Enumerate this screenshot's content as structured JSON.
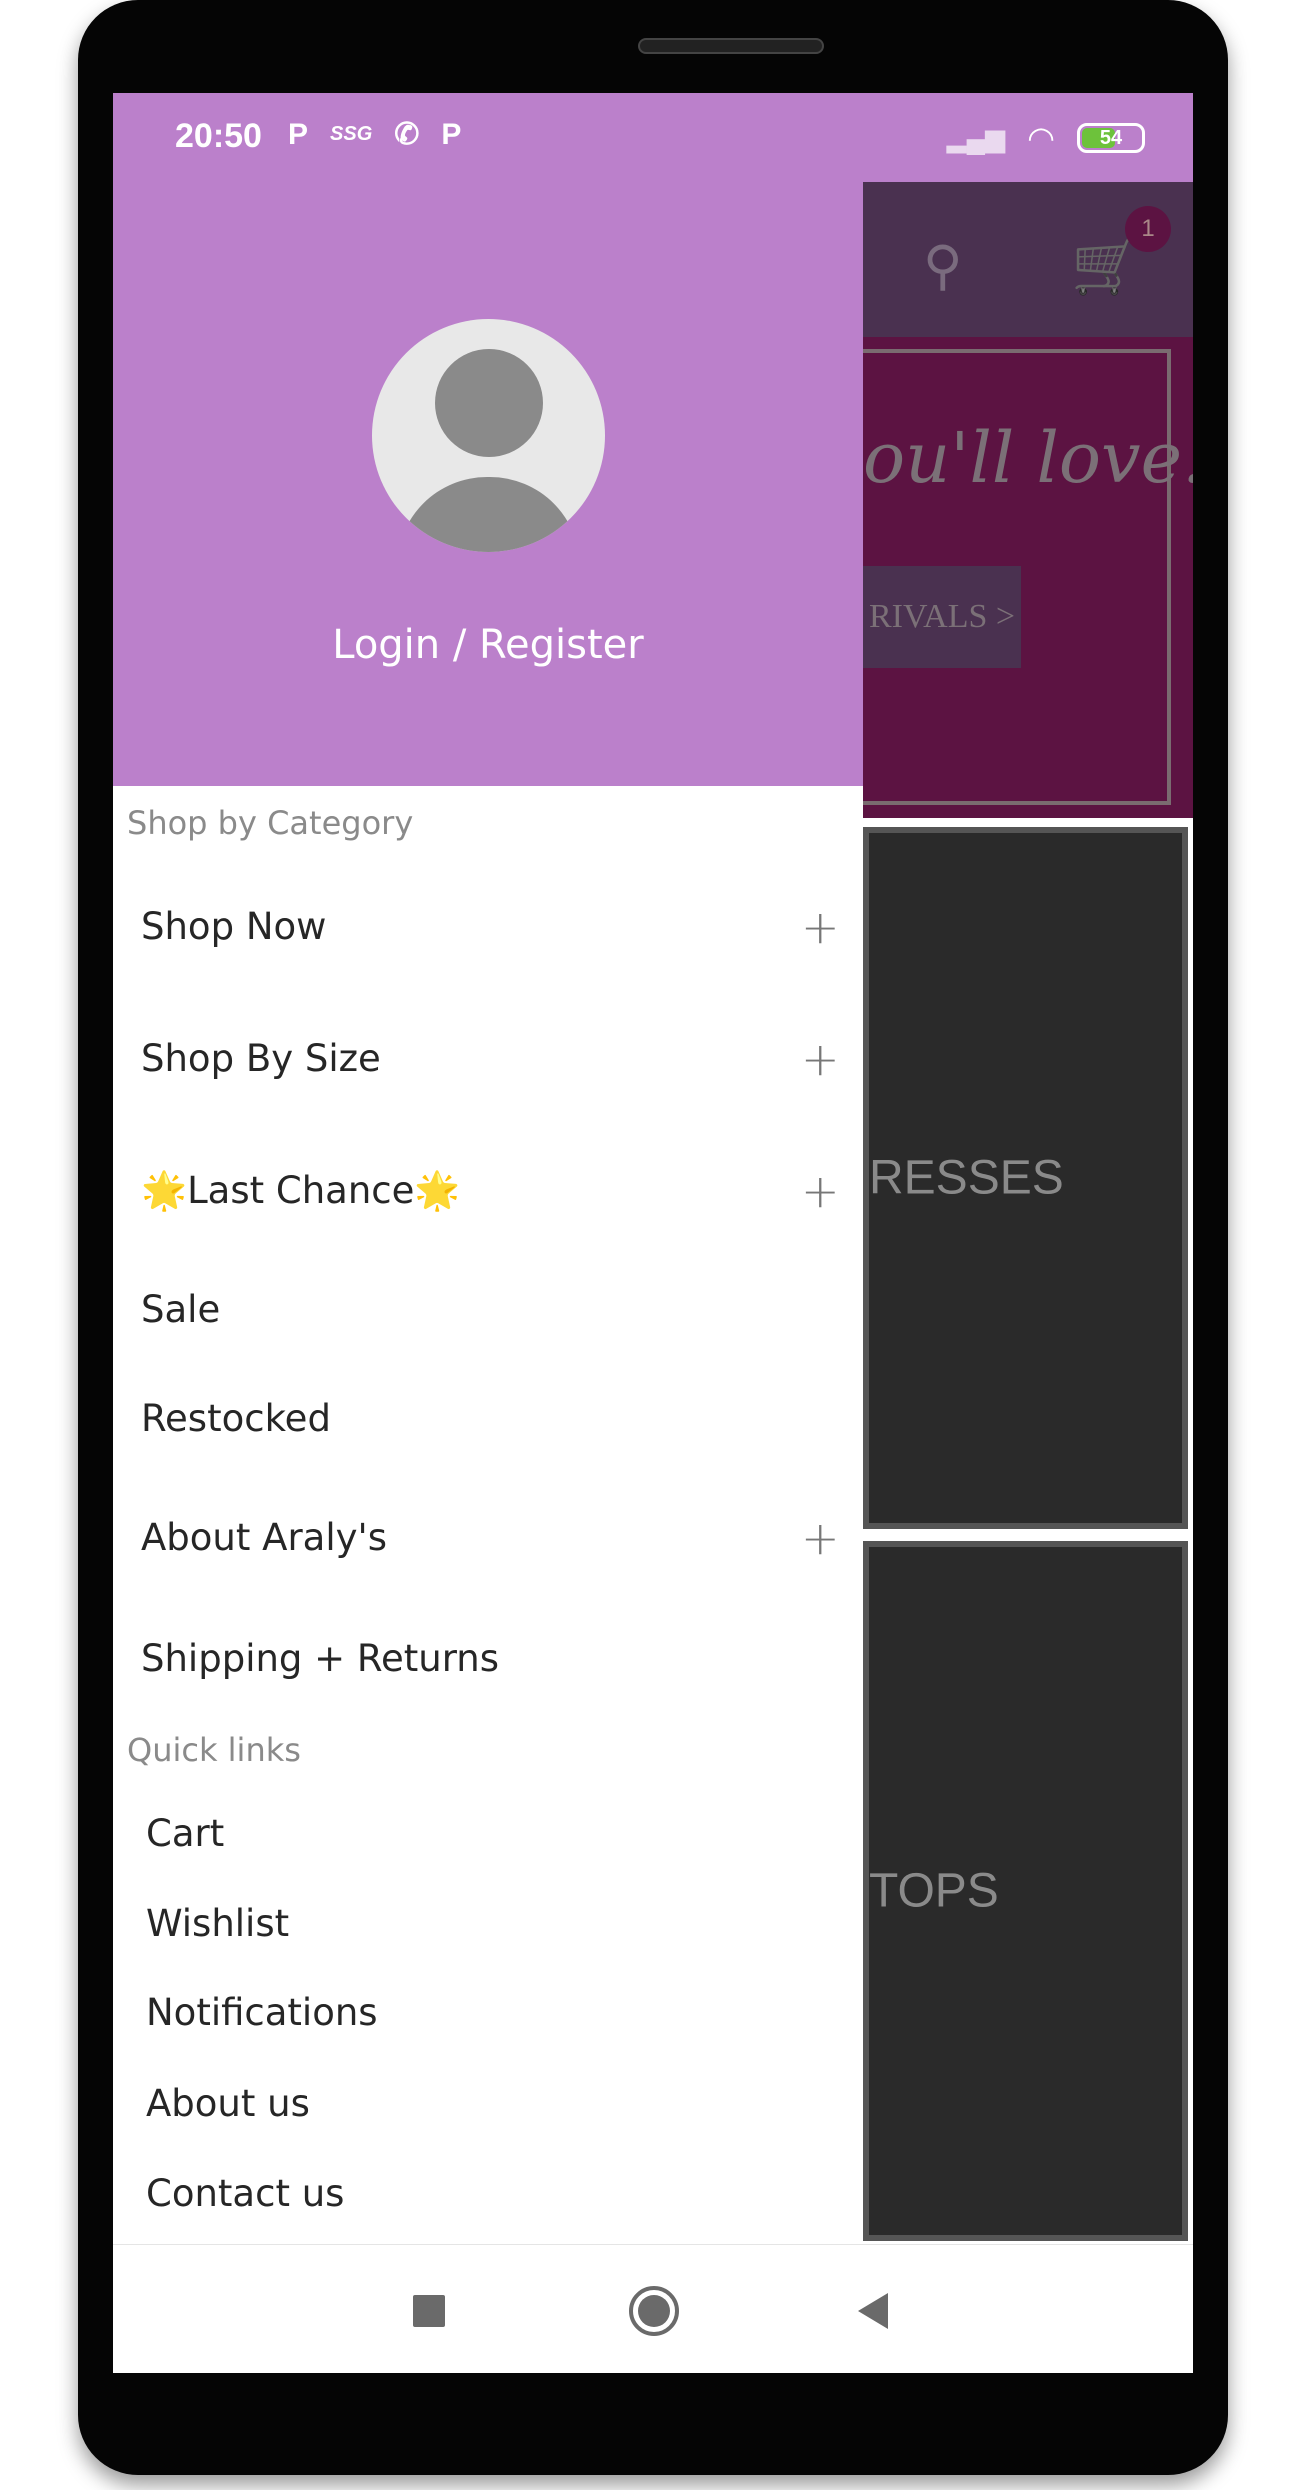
{
  "status_bar": {
    "time": "20:50",
    "notif_icons": [
      "P",
      "SSG",
      "whatsapp-icon",
      "P"
    ],
    "battery": "54",
    "color": "#bb80cb"
  },
  "background_app": {
    "cart_badge": "1",
    "banner_text": "ou'll love.",
    "banner_button": "RIVALS >",
    "tiles": [
      "RESSES",
      "TOPS"
    ]
  },
  "drawer": {
    "login_label": "Login / Register",
    "category_header": "Shop by Category",
    "categories": [
      {
        "label": "Shop Now",
        "expandable": true
      },
      {
        "label": "Shop By Size",
        "expandable": true
      },
      {
        "label": "🌟Last Chance🌟",
        "expandable": true
      },
      {
        "label": "Sale",
        "expandable": false
      },
      {
        "label": "Restocked",
        "expandable": false
      },
      {
        "label": "About Araly's",
        "expandable": true
      },
      {
        "label": "Shipping + Returns",
        "expandable": false
      }
    ],
    "quick_header": "Quick links",
    "quick_links": [
      "Cart",
      "Wishlist",
      "Notifications",
      "About us",
      "Contact us"
    ],
    "plus_glyph": "+"
  },
  "icons": {
    "search": "⚲",
    "cart": "🛒"
  }
}
